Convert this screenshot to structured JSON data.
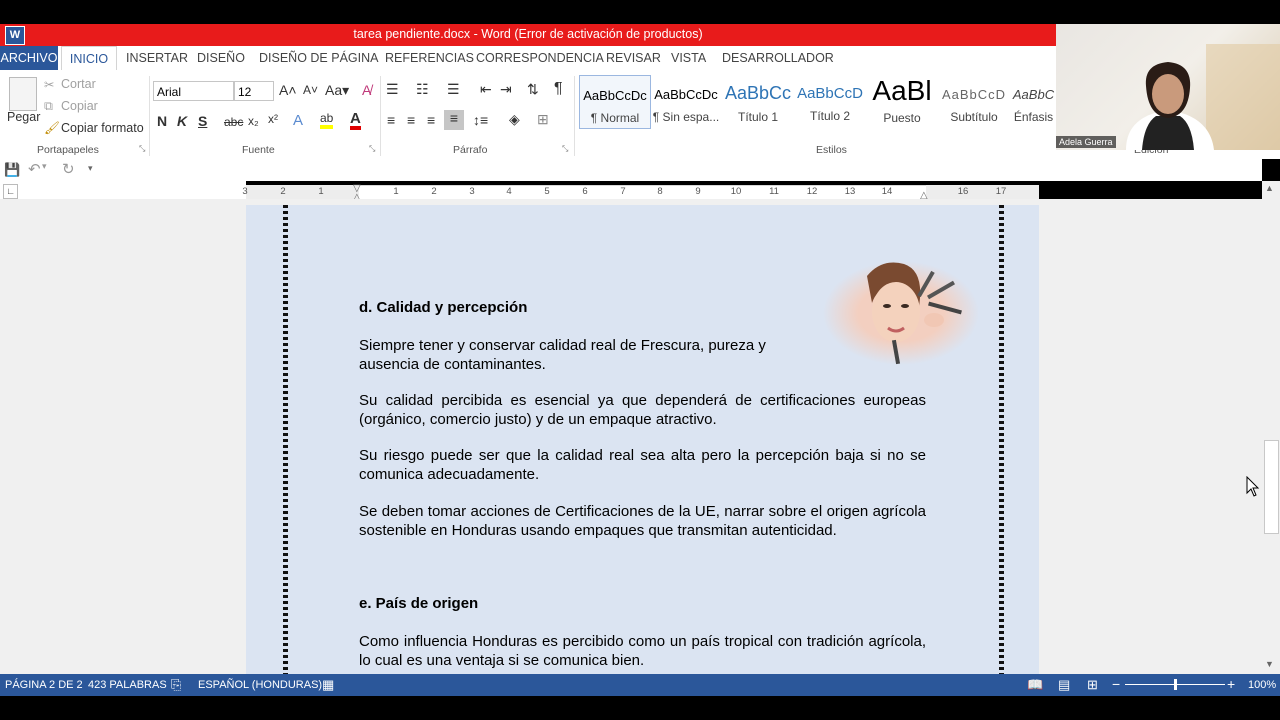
{
  "window": {
    "title": "tarea pendiente.docx -  Word (Error de activación de productos)",
    "app_icon_letter": "W"
  },
  "menu": {
    "archivo": "ARCHIVO",
    "tabs": [
      "INICIO",
      "INSERTAR",
      "DISEÑO",
      "DISEÑO DE PÁGINA",
      "REFERENCIAS",
      "CORRESPONDENCIA",
      "REVISAR",
      "VISTA",
      "DESARROLLADOR"
    ]
  },
  "ribbon": {
    "clipboard": {
      "paste": "Pegar",
      "cut": "Cortar",
      "copy": "Copiar",
      "format_painter": "Copiar formato",
      "label": "Portapapeles"
    },
    "font": {
      "name": "Arial",
      "size": "12",
      "bold": "N",
      "italic": "K",
      "underline": "S",
      "strike": "abc",
      "label": "Fuente"
    },
    "paragraph": {
      "label": "Párrafo"
    },
    "styles": {
      "label": "Estilos",
      "items": [
        {
          "preview": "AaBbCcDc",
          "name": "¶ Normal"
        },
        {
          "preview": "AaBbCcDc",
          "name": "¶ Sin espa..."
        },
        {
          "preview": "AaBbCc",
          "name": "Título 1"
        },
        {
          "preview": "AaBbCcD",
          "name": "Título 2"
        },
        {
          "preview": "AaBl",
          "name": "Puesto"
        },
        {
          "preview": "AaBbCcD",
          "name": "Subtítulo"
        },
        {
          "preview": "AaBbC",
          "name": "Énfasis"
        }
      ]
    },
    "editing_label": "Edición"
  },
  "ruler": {
    "numbers": [
      "3",
      "2",
      "1",
      "1",
      "2",
      "3",
      "4",
      "5",
      "6",
      "7",
      "8",
      "9",
      "10",
      "11",
      "12",
      "13",
      "14",
      "16",
      "17"
    ]
  },
  "document": {
    "heading_d": "d. Calidad y percepción",
    "p1": "Siempre tener y conservar calidad real de  Frescura, pureza y ausencia de contaminantes.",
    "p2": "Su calidad percibida es esencial ya que dependerá de certificaciones europeas (orgánico, comercio justo) y de un empaque atractivo.",
    "p3": "Su riesgo puede ser que la calidad real sea alta pero la percepción baja si no se comunica adecuadamente.",
    "p4": "Se deben tomar acciones de  Certificaciones de la UE, narrar  sobre el origen agrícola sostenible en Honduras usando  empaques que transmitan autenticidad.",
    "heading_e": "e. País de origen",
    "p5": "Como influencia Honduras es  percibido como un país tropical con tradición agrícola, lo cual es una ventaja si se comunica bien."
  },
  "status": {
    "page": "PÁGINA 2 DE 2",
    "words": "423 PALABRAS",
    "language": "ESPAÑOL (HONDURAS)",
    "zoom": "100%",
    "zoom_level": 0.5
  },
  "webcam": {
    "name": "Adela Guerra"
  },
  "colors": {
    "titlebar": "#e81b1b",
    "word_blue": "#2b579a",
    "page_bg": "#dbe4f2"
  }
}
